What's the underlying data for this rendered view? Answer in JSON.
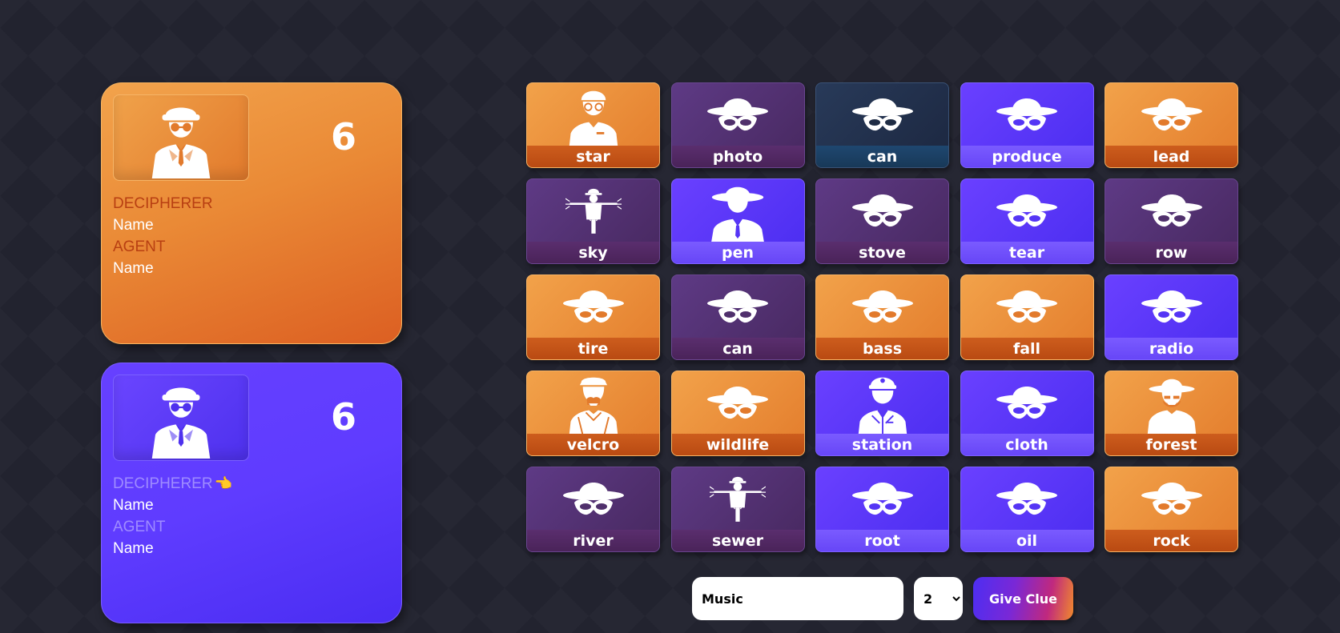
{
  "teams": [
    {
      "id": "red",
      "score": "6",
      "spymaster_icon": "spymaster-glasses-icon",
      "roles": [
        {
          "title": "DECIPHERER",
          "name": "Name"
        },
        {
          "title": "AGENT",
          "name": "Name"
        }
      ]
    },
    {
      "id": "blue",
      "score": "6",
      "spymaster_icon": "spymaster-glasses-icon",
      "roles": [
        {
          "title": "DECIPHERER",
          "name": "Name"
        },
        {
          "title": "AGENT",
          "name": "Name"
        }
      ]
    }
  ],
  "board": {
    "cards": [
      {
        "word": "star",
        "color": "red",
        "icon": "officer-icon"
      },
      {
        "word": "photo",
        "color": "neutral",
        "icon": "hidden-agent-icon"
      },
      {
        "word": "can",
        "color": "assassin",
        "icon": "hidden-agent-icon"
      },
      {
        "word": "produce",
        "color": "blue",
        "icon": "hidden-agent-icon"
      },
      {
        "word": "lead",
        "color": "red",
        "icon": "hidden-agent-icon"
      },
      {
        "word": "sky",
        "color": "neutral",
        "icon": "scarecrow-icon"
      },
      {
        "word": "pen",
        "color": "blue",
        "icon": "agent-fedora-icon"
      },
      {
        "word": "stove",
        "color": "neutral",
        "icon": "hidden-agent-icon"
      },
      {
        "word": "tear",
        "color": "blue",
        "icon": "hidden-agent-icon"
      },
      {
        "word": "row",
        "color": "neutral",
        "icon": "hidden-agent-icon"
      },
      {
        "word": "tire",
        "color": "red",
        "icon": "hidden-agent-icon"
      },
      {
        "word": "can",
        "color": "neutral",
        "icon": "hidden-agent-icon"
      },
      {
        "word": "bass",
        "color": "red",
        "icon": "hidden-agent-icon"
      },
      {
        "word": "fall",
        "color": "red",
        "icon": "hidden-agent-icon"
      },
      {
        "word": "radio",
        "color": "blue",
        "icon": "hidden-agent-icon"
      },
      {
        "word": "velcro",
        "color": "red",
        "icon": "sailor-icon"
      },
      {
        "word": "wildlife",
        "color": "red",
        "icon": "hidden-agent-icon"
      },
      {
        "word": "station",
        "color": "blue",
        "icon": "security-guard-icon"
      },
      {
        "word": "cloth",
        "color": "blue",
        "icon": "hidden-agent-icon"
      },
      {
        "word": "forest",
        "color": "red",
        "icon": "cowboy-bearded-icon"
      },
      {
        "word": "river",
        "color": "neutral",
        "icon": "hidden-agent-icon"
      },
      {
        "word": "sewer",
        "color": "neutral",
        "icon": "scarecrow-icon"
      },
      {
        "word": "root",
        "color": "blue",
        "icon": "hidden-agent-icon"
      },
      {
        "word": "oil",
        "color": "blue",
        "icon": "hidden-agent-icon"
      },
      {
        "word": "rock",
        "color": "red",
        "icon": "hidden-agent-icon"
      }
    ]
  },
  "clue": {
    "input_value": "Music",
    "count_value": "2",
    "count_options": [
      "2"
    ],
    "button_label": "Give Clue"
  },
  "colors": {
    "red": "#ea8a36",
    "blue": "#5f3cff",
    "neutral": "#5a3a7e",
    "assassin": "#22304a",
    "background": "#22232f"
  }
}
